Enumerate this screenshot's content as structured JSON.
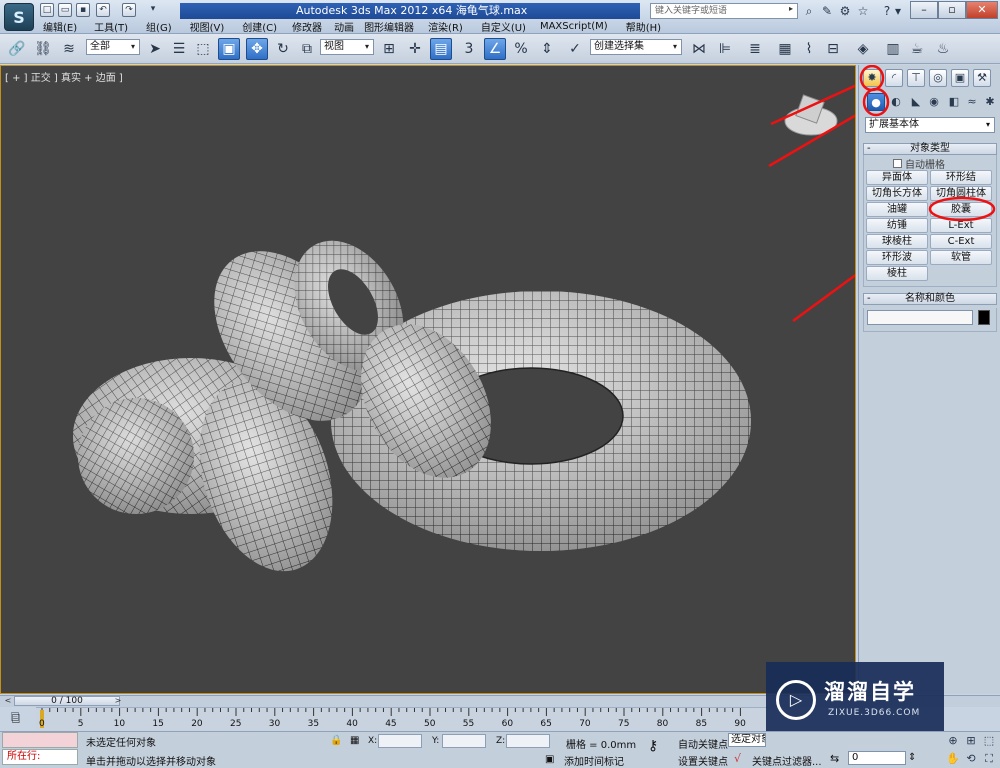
{
  "title_bar": {
    "app_logo": "S",
    "title": "Autodesk 3ds Max  2012 x64     海龟气球.max",
    "search_placeholder": "键入关键字或短语",
    "right_icons": [
      "binoculars-icon",
      "wrench-icon",
      "star-icon",
      "help-icon"
    ]
  },
  "menu": [
    "编辑(E)",
    "工具(T)",
    "组(G)",
    "视图(V)",
    "创建(C)",
    "修改器",
    "动画",
    "图形编辑器",
    "渲染(R)",
    "自定义(U)",
    "MAXScript(M)",
    "帮助(H)"
  ],
  "toolbar": {
    "selection_filter": "全部",
    "reference_coord": "视图",
    "named_selection": "创建选择集",
    "snap_label": "3",
    "percent_label": "%"
  },
  "viewport": {
    "label": "[ + ] 正交 ] 真实 + 边面 ]",
    "background": "#434343",
    "border_color": "#c48f15"
  },
  "command_panel": {
    "dropdown": "扩展基本体",
    "rollout_object_type": "对象类型",
    "autogrid": "自动栅格",
    "buttons": [
      "异面体",
      "环形结",
      "切角长方体",
      "切角圆柱体",
      "油罐",
      "胶囊",
      "纺锤",
      "L-Ext",
      "球棱柱",
      "C-Ext",
      "环形波",
      "软管",
      "棱柱"
    ],
    "rollout_name_color": "名称和颜色",
    "rollout_minus": "-"
  },
  "time_slider": {
    "position": "0 / 100",
    "prev": "<",
    "next": ">"
  },
  "trackbar": {
    "ticks": [
      "0",
      "5",
      "10",
      "15",
      "20",
      "25",
      "30",
      "35",
      "40",
      "45",
      "50",
      "55",
      "60",
      "65",
      "70",
      "75",
      "80",
      "85",
      "90"
    ]
  },
  "status": {
    "listener_label": "",
    "listener_line": "所在行:",
    "selection": "未选定任何对象",
    "prompt": "单击并拖动以选择并移动对象",
    "x_label": "X:",
    "y_label": "Y:",
    "z_label": "Z:",
    "grid": "栅格 = 0.0mm",
    "add_time_tag": "添加时间标记",
    "auto_key": "自动关键点",
    "set_key": "设置关键点",
    "selected": "选定对象",
    "key_filters": "关键点过滤器...",
    "frame": "0"
  },
  "watermark": {
    "title": "溜溜自学",
    "url": "ZIXUE.3D66.COM"
  }
}
